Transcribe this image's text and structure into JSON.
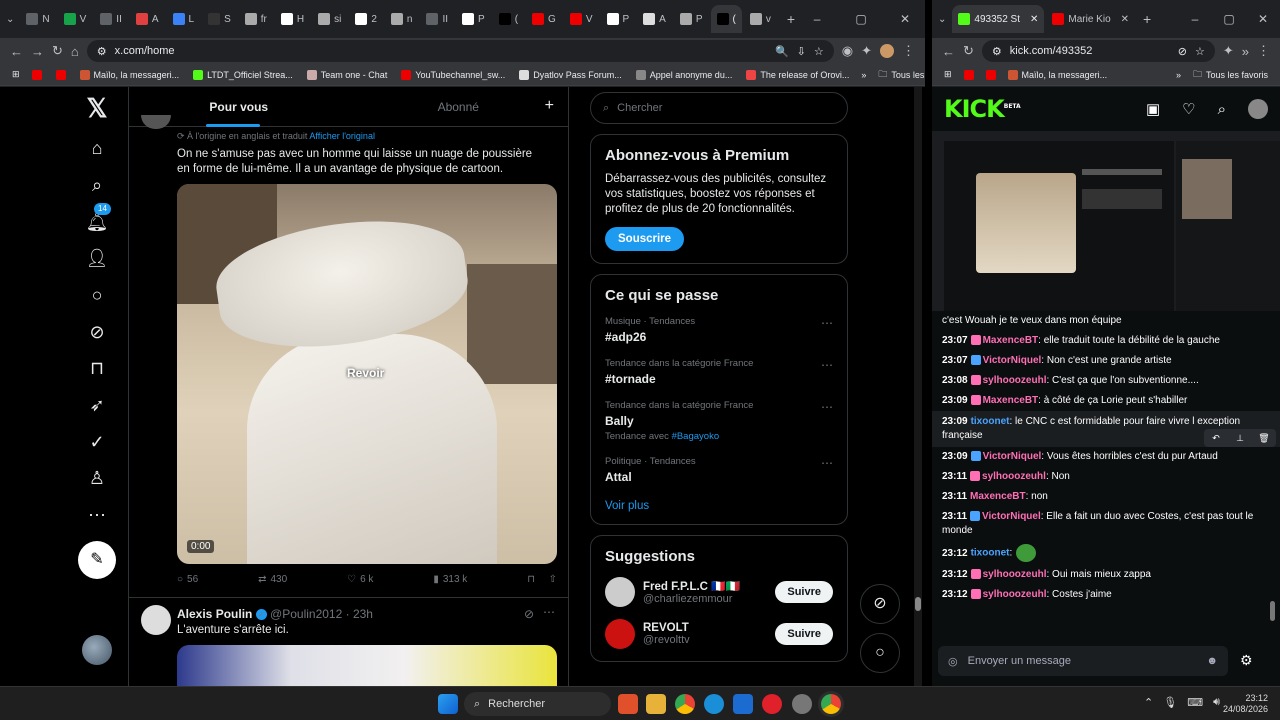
{
  "left_browser": {
    "tabs": [
      {
        "label": "N",
        "color": "#5f6368"
      },
      {
        "label": "V",
        "color": "#16a34a"
      },
      {
        "label": "II",
        "color": "#5f6368"
      },
      {
        "label": "A",
        "color": "#e04040"
      },
      {
        "label": "L",
        "color": "#3b82f6"
      },
      {
        "label": "S",
        "color": "#333"
      },
      {
        "label": "fr",
        "color": "#aaa"
      },
      {
        "label": "H",
        "color": "#fff"
      },
      {
        "label": "si",
        "color": "#aaa"
      },
      {
        "label": "2",
        "color": "#fff"
      },
      {
        "label": "n",
        "color": "#aaa"
      },
      {
        "label": "II",
        "color": "#5f6368"
      },
      {
        "label": "P",
        "color": "#fff"
      },
      {
        "label": "(",
        "color": "#000"
      },
      {
        "label": "G",
        "color": "#e00"
      },
      {
        "label": "V",
        "color": "#e00"
      },
      {
        "label": "P",
        "color": "#fff"
      },
      {
        "label": "A",
        "color": "#ddd"
      },
      {
        "label": "P",
        "color": "#aaa"
      },
      {
        "label": "(",
        "color": "#000"
      },
      {
        "label": "v",
        "color": "#aaa"
      }
    ],
    "url": "x.com/home",
    "bookmarks": [
      {
        "label": "",
        "color": "#e00"
      },
      {
        "label": "",
        "color": "#e00"
      },
      {
        "label": "Maïlo, la messageri...",
        "color": "#c53"
      },
      {
        "label": "LTDT_Officiel Strea...",
        "color": "#53fc18"
      },
      {
        "label": "Team one - Chat",
        "color": "#caa"
      },
      {
        "label": "YouTubechannel_sw...",
        "color": "#e00"
      },
      {
        "label": "Dyatlov Pass Forum...",
        "color": "#ddd"
      },
      {
        "label": "Appel anonyme du...",
        "color": "#888"
      },
      {
        "label": "The release of Orovi...",
        "color": "#e44"
      }
    ],
    "bookmarks_folder": "Tous les favoris"
  },
  "right_browser": {
    "tabs": [
      {
        "label": "493352 St",
        "color": "#53fc18"
      },
      {
        "label": "Marie Kio",
        "color": "#e00"
      }
    ],
    "url": "kick.com/493352",
    "bookmarks": [
      {
        "label": "",
        "color": "#e00"
      },
      {
        "label": "",
        "color": "#e00"
      },
      {
        "label": "Maïlo, la messageri...",
        "color": "#c53"
      }
    ],
    "bookmarks_folder": "Tous les favoris"
  },
  "x": {
    "tabs": [
      "Pour vous",
      "Abonné"
    ],
    "notif_count": "14",
    "tweet1": {
      "translated": "À l'origine en anglais et traduit",
      "show_original": "Afficher l'original",
      "text": "On ne s'amuse pas avec un homme qui laisse un nuage de poussière en forme de lui-même. Il a un avantage de physique de cartoon.",
      "replay": "Revoir",
      "video_time": "0:00",
      "replies": "56",
      "reposts": "430",
      "likes": "6 k",
      "views": "313 k"
    },
    "tweet2": {
      "name": "Alexis Poulin",
      "handle": "@Poulin2012 · 23h",
      "text": "L'aventure s'arrête ici."
    },
    "search_placeholder": "Chercher",
    "premium": {
      "title": "Abonnez-vous à Premium",
      "text": "Débarrassez-vous des publicités, consultez vos statistiques, boostez vos réponses et profitez de plus de 20 fonctionnalités.",
      "button": "Souscrire"
    },
    "trends_title": "Ce qui se passe",
    "trends": [
      {
        "cat": "Musique · Tendances",
        "name": "#adp26",
        "with": "",
        "with_tag": ""
      },
      {
        "cat": "Tendance dans la catégorie France",
        "name": "#tornade",
        "with": "",
        "with_tag": ""
      },
      {
        "cat": "Tendance dans la catégorie France",
        "name": "Bally",
        "with": "Tendance avec",
        "with_tag": "#Bagayoko"
      },
      {
        "cat": "Politique · Tendances",
        "name": "Attal",
        "with": "",
        "with_tag": ""
      }
    ],
    "see_more": "Voir plus",
    "suggestions_title": "Suggestions",
    "suggestions": [
      {
        "name": "Fred F.P.L.C 🇫🇷🇮🇹",
        "handle": "@charliezemmour",
        "button": "Suivre",
        "color": "#ccc"
      },
      {
        "name": "REVOLT",
        "handle": "@revolttv",
        "button": "Suivre",
        "color": "#c11"
      }
    ]
  },
  "kick": {
    "logo": "KICK",
    "logo_beta": "BETA",
    "chat": [
      {
        "time": "",
        "user": "",
        "color": "#fff",
        "text": "c'est Wouah je te veux dans mon équipe",
        "badge": ""
      },
      {
        "time": "23:07",
        "user": "MaxenceBT",
        "color": "#ff6fb5",
        "text": ": elle traduit toute la débilité de la gauche",
        "badge": "#ff6fb5"
      },
      {
        "time": "23:07",
        "user": "VictorNiquel",
        "color": "#ff6fb5",
        "text": ": Non c'est une grande artiste",
        "badge": "#4aa3ff"
      },
      {
        "time": "23:08",
        "user": "sylhooozeuhl",
        "color": "#ff6fb5",
        "text": ": C'est ça que l'on subventionne....",
        "badge": "#ff6fb5"
      },
      {
        "time": "23:09",
        "user": "MaxenceBT",
        "color": "#ff6fb5",
        "text": ": à côté de ça Lorie peut s'habiller",
        "badge": "#ff6fb5"
      },
      {
        "time": "23:09",
        "user": "tixoonet",
        "color": "#4aa3ff",
        "text": ": le CNC c est formidable pour faire vivre l exception française",
        "badge": ""
      },
      {
        "time": "23:09",
        "user": "VictorNiquel",
        "color": "#ff6fb5",
        "text": ": Vous êtes horribles c'est du pur Artaud",
        "badge": "#4aa3ff"
      },
      {
        "time": "23:11",
        "user": "sylhooozeuhl",
        "color": "#ff6fb5",
        "text": ": Non",
        "badge": "#ff6fb5"
      },
      {
        "time": "23:11",
        "user": "MaxenceBT",
        "color": "#ff6fb5",
        "text": ": non",
        "badge": ""
      },
      {
        "time": "23:11",
        "user": "VictorNiquel",
        "color": "#ff6fb5",
        "text": ": Elle a fait un duo avec Costes, c'est pas tout le monde",
        "badge": "#4aa3ff"
      },
      {
        "time": "23:12",
        "user": "tixoonet",
        "color": "#4aa3ff",
        "text": ":",
        "badge": ""
      },
      {
        "time": "23:12",
        "user": "sylhooozeuhl",
        "color": "#ff6fb5",
        "text": ": Oui mais mieux zappa",
        "badge": "#ff6fb5"
      },
      {
        "time": "23:12",
        "user": "sylhooozeuhl",
        "color": "#ff6fb5",
        "text": ": Costes j'aime",
        "badge": "#ff6fb5"
      }
    ],
    "input_placeholder": "Envoyer un message"
  },
  "taskbar": {
    "search": "Rechercher",
    "time": "23:12",
    "date": "24/08/2026"
  }
}
